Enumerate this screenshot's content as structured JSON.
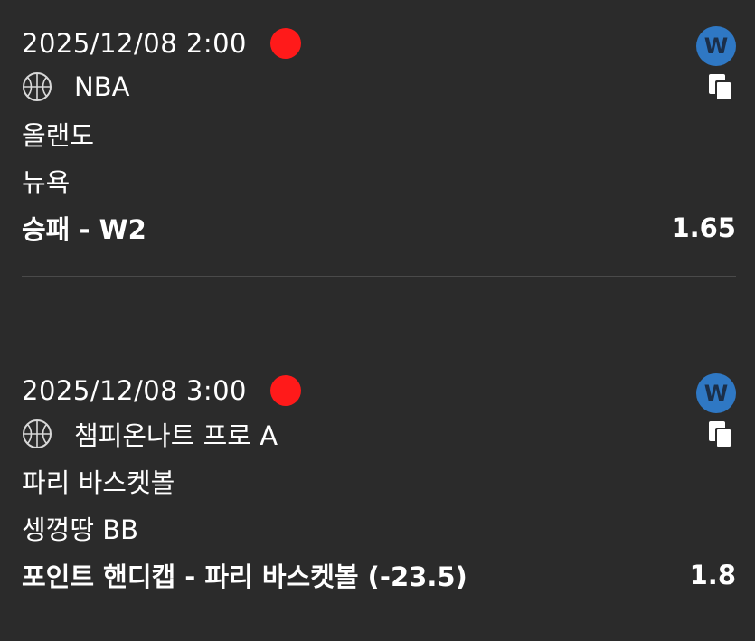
{
  "bets": [
    {
      "datetime": "2025/12/08 2:00",
      "badge": "W",
      "league": "NBA",
      "team1": "올랜도",
      "team2": "뉴욕",
      "market": "승패 - W2",
      "odds": "1.65"
    },
    {
      "datetime": "2025/12/08 3:00",
      "badge": "W",
      "league": "챔피온나트 프로 A",
      "team1": "파리 바스켓볼",
      "team2": "셍껑땅 BB",
      "market": "포인트 핸디캡 - 파리 바스켓볼 (-23.5)",
      "odds": "1.8"
    }
  ],
  "colors": {
    "background": "#2b2b2b",
    "live_dot": "#ff1a1a",
    "badge": "#2f78c4",
    "divider": "#4a4a4a"
  },
  "icons": {
    "sport": "basketball-icon",
    "copy": "copy-icon",
    "status": "live-dot-icon"
  }
}
